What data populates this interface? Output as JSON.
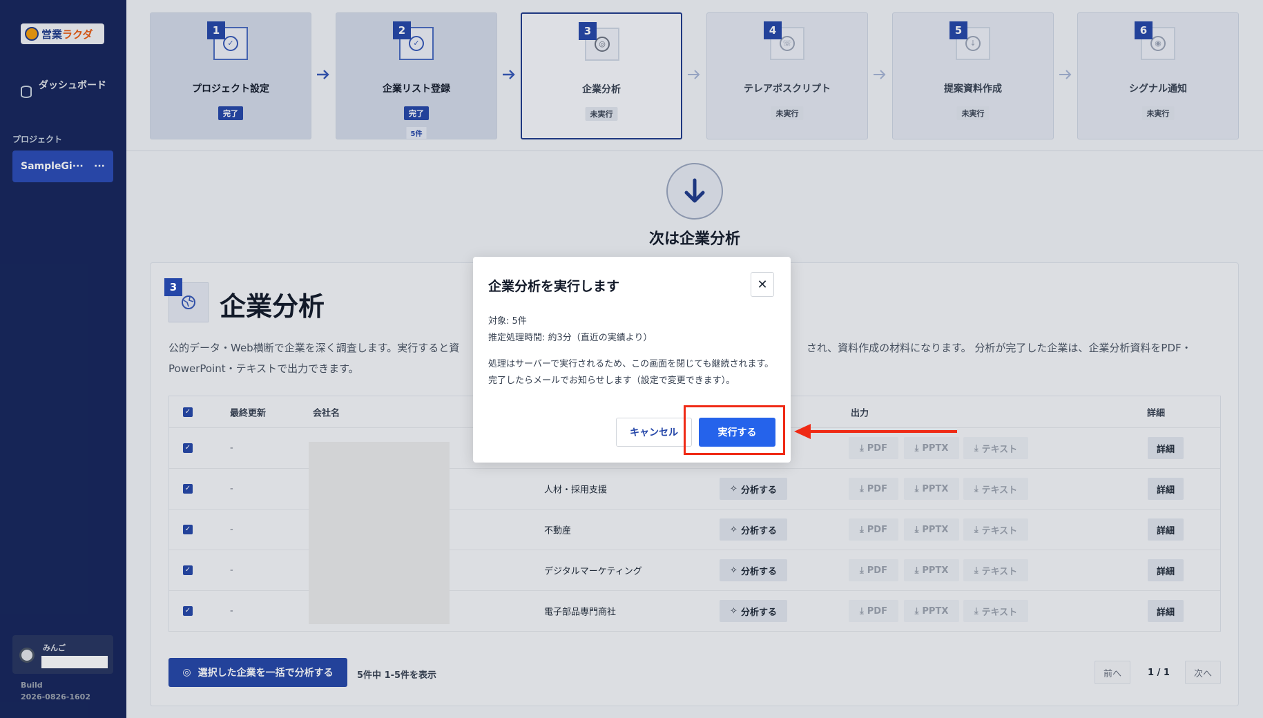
{
  "sidebar": {
    "logo_prefix": "営業",
    "logo_accent": "ラクダ",
    "dashboard_label": "ダッシュボード",
    "section_label": "プロジェクト",
    "project_name": "SampleGi···",
    "project_more": "···",
    "user_name": "みんご",
    "build_label": "Build",
    "build_id": "2026-0826-1602"
  },
  "steps": [
    {
      "num": "1",
      "title": "プロジェクト設定",
      "status": "完了",
      "icon": "check-icon"
    },
    {
      "num": "2",
      "title": "企業リスト登録",
      "status": "完了",
      "count": "5件",
      "icon": "check-icon"
    },
    {
      "num": "3",
      "title": "企業分析",
      "status": "未実行",
      "icon": "globe-icon"
    },
    {
      "num": "4",
      "title": "テレアポスクリプト",
      "status": "未実行",
      "icon": "phone-icon"
    },
    {
      "num": "5",
      "title": "提案資料作成",
      "status": "未実行",
      "icon": "document-download-icon"
    },
    {
      "num": "6",
      "title": "シグナル通知",
      "status": "未実行",
      "icon": "radar-icon"
    }
  ],
  "next": {
    "title": "次は企業分析"
  },
  "card": {
    "num": "3",
    "title": "企業分析",
    "desc_left": "公的データ・Web横断で企業を深く調査します。実行すると資",
    "desc_right": "され、資料作成の材料になります。 分析が完了した企業は、企業分析資料をPDF・",
    "desc_line2": "PowerPoint・テキストで出力できます。"
  },
  "table": {
    "headers": {
      "updated": "最終更新",
      "company": "会社名",
      "output": "出力",
      "detail": "詳細"
    },
    "rows": [
      {
        "updated": "-",
        "industry": "",
        "show_analyze": false
      },
      {
        "updated": "-",
        "industry": "人材・採用支援",
        "show_analyze": true
      },
      {
        "updated": "-",
        "industry": "不動産",
        "show_analyze": true
      },
      {
        "updated": "-",
        "industry": "デジタルマーケティング",
        "show_analyze": true
      },
      {
        "updated": "-",
        "industry": "電子部品専門商社",
        "show_analyze": true
      }
    ],
    "analyze_label": "分析する",
    "pdf_label": "PDF",
    "pptx_label": "PPTX",
    "text_label": "テキスト",
    "detail_label": "詳細"
  },
  "footer": {
    "bulk_label": "選択した企業を一括で分析する",
    "showing": "5件中 1-5件を表示",
    "prev": "前へ",
    "page": "1 / 1",
    "next": "次へ"
  },
  "modal": {
    "title": "企業分析を実行します",
    "target": "対象: 5件",
    "estimate": "推定処理時間: 約3分（直近の実績より）",
    "note": "処理はサーバーで実行されるため、この画面を閉じても継続されます。完了したらメールでお知らせします（設定で変更できます）。",
    "cancel": "キャンセル",
    "execute": "実行する"
  },
  "colors": {
    "sidebar": "#15245a",
    "primary": "#2446a8",
    "execute": "#2563eb",
    "highlight": "#ef2a15"
  }
}
